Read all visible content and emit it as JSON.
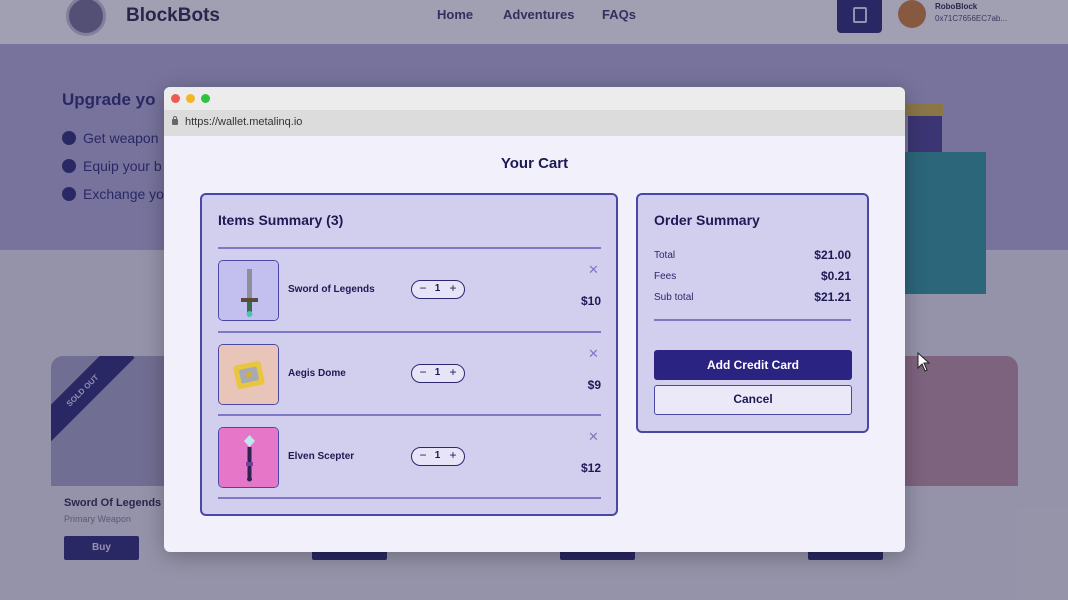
{
  "background": {
    "brand": "BlockBots",
    "nav": [
      "Home",
      "Adventures",
      "FAQs"
    ],
    "user_name": "RoboBlock",
    "wallet_address": "0x71C7656EC7ab...",
    "hero_title": "Upgrade yo",
    "bullets": [
      "Get weapon",
      "Equip your b",
      "Exchange yo"
    ],
    "card": {
      "badge": "SOLD OUT",
      "title": "Sword Of Legends",
      "subtitle": "Primary Weapon",
      "buy_label": "Buy"
    }
  },
  "browser": {
    "url": "https://wallet.metalinq.io"
  },
  "cart": {
    "title": "Your Cart",
    "items_summary_title": "Items Summary (3)",
    "items": [
      {
        "name": "Sword of Legends",
        "quantity": "1",
        "price": "$10",
        "thumb_color": "#c3bfee"
      },
      {
        "name": "Aegis Dome",
        "quantity": "1",
        "price": "$9",
        "thumb_color": "#e8c5b8"
      },
      {
        "name": "Elven Scepter",
        "quantity": "1",
        "price": "$12",
        "thumb_color": "#e576c8"
      }
    ],
    "stepper": {
      "minus": "−",
      "plus": "+"
    },
    "remove_symbol": "✕"
  },
  "order_summary": {
    "title": "Order Summary",
    "rows": [
      {
        "label": "Total",
        "value": "$21.00"
      },
      {
        "label": "Fees",
        "value": "$0.21"
      },
      {
        "label": "Sub total",
        "value": "$21.21"
      }
    ],
    "add_card_label": "Add Credit Card",
    "cancel_label": "Cancel"
  },
  "colors": {
    "accent": "#2b2382",
    "panel_bg": "#d2cfee",
    "panel_border": "#4b47a4"
  }
}
